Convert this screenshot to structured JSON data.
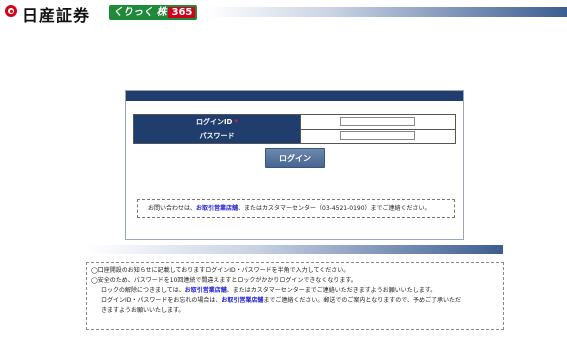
{
  "header": {
    "brand_name": "日産証券",
    "service_prefix": "くりっく",
    "service_kanji": "株",
    "service_number": "365"
  },
  "login_form": {
    "id_label": "ログインID",
    "required_mark": "*",
    "password_label": "パスワード",
    "id_value": "",
    "password_value": "",
    "login_button": "ログイン"
  },
  "contact": {
    "prefix": "お問い合わせは、",
    "branch_link": "お取引営業店舗",
    "suffix": "、またはカスタマーセンター（03-4521-0190）までご連絡ください。"
  },
  "notices": {
    "line1": "◯口座開設のお知らせに記載しておりますログインID・パスワードを半角で入力してください。",
    "line2": "◯安全のため、パスワードを10回連続で間違えますとロックがかかりログインできなくなります。",
    "line3_prefix": "ロックの解除につきましては、",
    "line3_link": "お取引営業店舗",
    "line3_suffix": "、またはカスタマーセンターまでご連絡いただきますようお願いいたします。",
    "line4_prefix": "ログインID・パスワードをお忘れの場合は、",
    "line4_link": "お取引営業店舗",
    "line4_suffix": "までご連絡ください。郵送でのご案内となりますので、予めご了承いただ",
    "line5": "きますようお願いいたします。"
  },
  "colors": {
    "navy": "#1f3e6e",
    "link": "#1a1ad0",
    "brand_red": "#d0021b",
    "badge_green": "#1e8a3a"
  }
}
